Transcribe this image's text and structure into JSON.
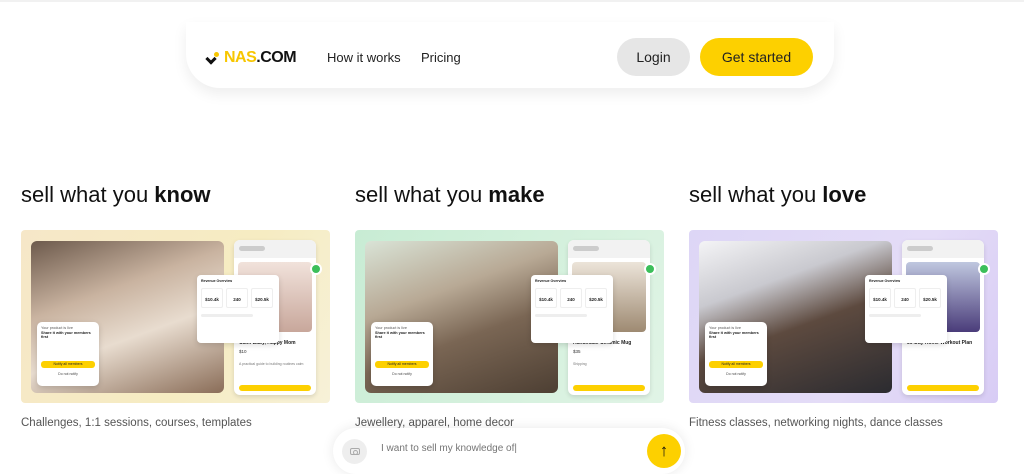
{
  "nav": {
    "logo_text": "NAS",
    "logo_suffix": ".COM",
    "links": [
      "How it works",
      "Pricing"
    ],
    "login_label": "Login",
    "start_label": "Get started"
  },
  "columns": [
    {
      "heading_pre": "sell what you ",
      "heading_bold": "know",
      "caption": "Challenges, 1:1 sessions, courses, templates",
      "product_title": "Calm Baby, Happy Mom",
      "product_price": "$10",
      "product_desc": "A practical guide to building routines calm"
    },
    {
      "heading_pre": "sell what you ",
      "heading_bold": "make",
      "caption": "Jewellery, apparel, home decor",
      "product_title": "Handmade Ceramic Mug",
      "product_price": "$35",
      "product_desc": "Shipping"
    },
    {
      "heading_pre": "sell what you ",
      "heading_bold": "love",
      "caption": "Fitness classes, networking nights, dance classes",
      "product_title": "30-Day Home Workout Plan",
      "product_price": "",
      "product_desc": ""
    }
  ],
  "overview": {
    "title": "Revenue Overview",
    "stat_a": "$10.4k",
    "stat_b": "240",
    "stat_c": "$20.5k"
  },
  "member_popup": {
    "line1": "Your product is live",
    "line2": "Share it with your members first",
    "button": "Notify all members",
    "skip": "Do not notify"
  },
  "prompt": {
    "placeholder": "I want to sell my knowledge of|",
    "send_icon": "↑"
  },
  "colors": {
    "accent": "#fdd000",
    "check": "#3cbf5a"
  }
}
